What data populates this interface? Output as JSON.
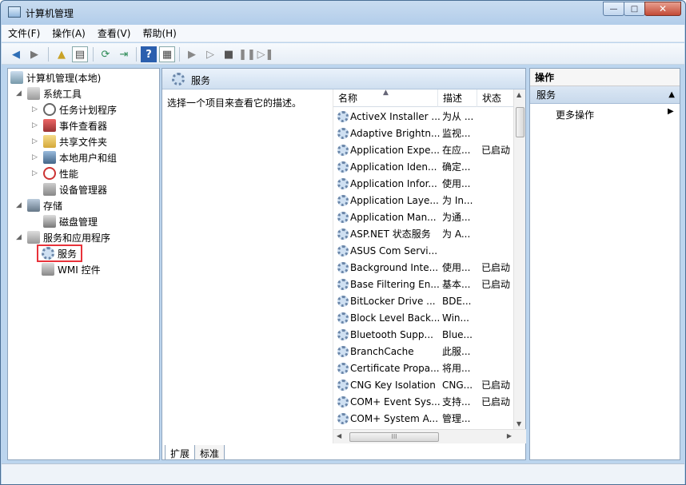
{
  "window": {
    "title": "计算机管理"
  },
  "window_controls": {
    "minimize": "—",
    "maximize": "□",
    "close": "✕"
  },
  "menu": {
    "file": "文件(F)",
    "action": "操作(A)",
    "view": "查看(V)",
    "help": "帮助(H)"
  },
  "toolbar_icons": [
    "back-icon",
    "forward-icon",
    "up-folder-icon",
    "show-hide-tree-icon",
    "refresh-icon",
    "export-icon",
    "help-icon",
    "properties-icon",
    "play-icon",
    "play-alt-icon",
    "stop-icon",
    "pause-icon",
    "restart-icon"
  ],
  "tree": {
    "root": "计算机管理(本地)",
    "system_tools": "系统工具",
    "task_scheduler": "任务计划程序",
    "event_viewer": "事件查看器",
    "shared_folders": "共享文件夹",
    "local_users": "本地用户和组",
    "performance": "性能",
    "device_manager": "设备管理器",
    "storage": "存储",
    "disk_management": "磁盘管理",
    "services_apps": "服务和应用程序",
    "services": "服务",
    "wmi": "WMI 控件"
  },
  "center": {
    "header": "服务",
    "description": "选择一个项目来查看它的描述。",
    "columns": {
      "name": "名称",
      "desc": "描述",
      "status": "状态"
    },
    "rows": [
      {
        "name": "ActiveX Installer ...",
        "desc": "为从 ...",
        "status": ""
      },
      {
        "name": "Adaptive Brightn...",
        "desc": "监视...",
        "status": ""
      },
      {
        "name": "Application Expe...",
        "desc": "在应...",
        "status": "已启动"
      },
      {
        "name": "Application Iden...",
        "desc": "确定...",
        "status": ""
      },
      {
        "name": "Application Infor...",
        "desc": "使用...",
        "status": ""
      },
      {
        "name": "Application Laye...",
        "desc": "为 In...",
        "status": ""
      },
      {
        "name": "Application Man...",
        "desc": "为通...",
        "status": ""
      },
      {
        "name": "ASP.NET 状态服务",
        "desc": "为 A...",
        "status": ""
      },
      {
        "name": "ASUS Com Servi...",
        "desc": "",
        "status": ""
      },
      {
        "name": "Background Inte...",
        "desc": "使用...",
        "status": "已启动"
      },
      {
        "name": "Base Filtering En...",
        "desc": "基本...",
        "status": "已启动"
      },
      {
        "name": "BitLocker Drive ...",
        "desc": "BDE...",
        "status": ""
      },
      {
        "name": "Block Level Back...",
        "desc": "Win...",
        "status": ""
      },
      {
        "name": "Bluetooth Supp...",
        "desc": "Blue...",
        "status": ""
      },
      {
        "name": "BranchCache",
        "desc": "此服...",
        "status": ""
      },
      {
        "name": "Certificate Propa...",
        "desc": "将用...",
        "status": ""
      },
      {
        "name": "CNG Key Isolation",
        "desc": "CNG...",
        "status": "已启动"
      },
      {
        "name": "COM+ Event Sys...",
        "desc": "支持...",
        "status": "已启动"
      },
      {
        "name": "COM+ System A...",
        "desc": "管理...",
        "status": ""
      }
    ],
    "hscroll_grip": "III",
    "tabs": {
      "extended": "扩展",
      "standard": "标准"
    }
  },
  "actions": {
    "title": "操作",
    "section": "服务",
    "more": "更多操作"
  }
}
